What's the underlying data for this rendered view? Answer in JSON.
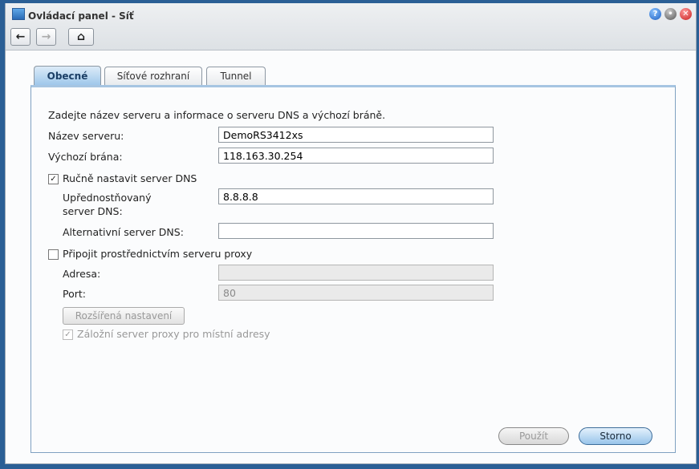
{
  "window": {
    "title": "Ovládací panel - Síť"
  },
  "tabs": [
    {
      "label": "Obecné",
      "active": true
    },
    {
      "label": "Síťové rozhraní"
    },
    {
      "label": "Tunnel"
    }
  ],
  "form": {
    "intro": "Zadejte název serveru a informace o serveru DNS a výchozí bráně.",
    "server_name_label": "Název serveru:",
    "server_name": "DemoRS3412xs",
    "gateway_label": "Výchozí brána:",
    "gateway": "118.163.30.254",
    "manual_dns_label": "Ručně nastavit server DNS",
    "manual_dns_checked": true,
    "preferred_dns_label_1": "Upřednostňovaný",
    "preferred_dns_label_2": "server DNS:",
    "preferred_dns": "8.8.8.8",
    "alt_dns_label": "Alternativní server DNS:",
    "alt_dns": "",
    "proxy_label": "Připojit prostřednictvím serveru proxy",
    "proxy_checked": false,
    "address_label": "Adresa:",
    "address": "",
    "port_label": "Port:",
    "port": "80",
    "advanced_label": "Rozšířená nastavení",
    "bypass_label": "Záložní server proxy pro místní adresy",
    "bypass_checked": true
  },
  "buttons": {
    "apply": "Použít",
    "cancel": "Storno"
  }
}
